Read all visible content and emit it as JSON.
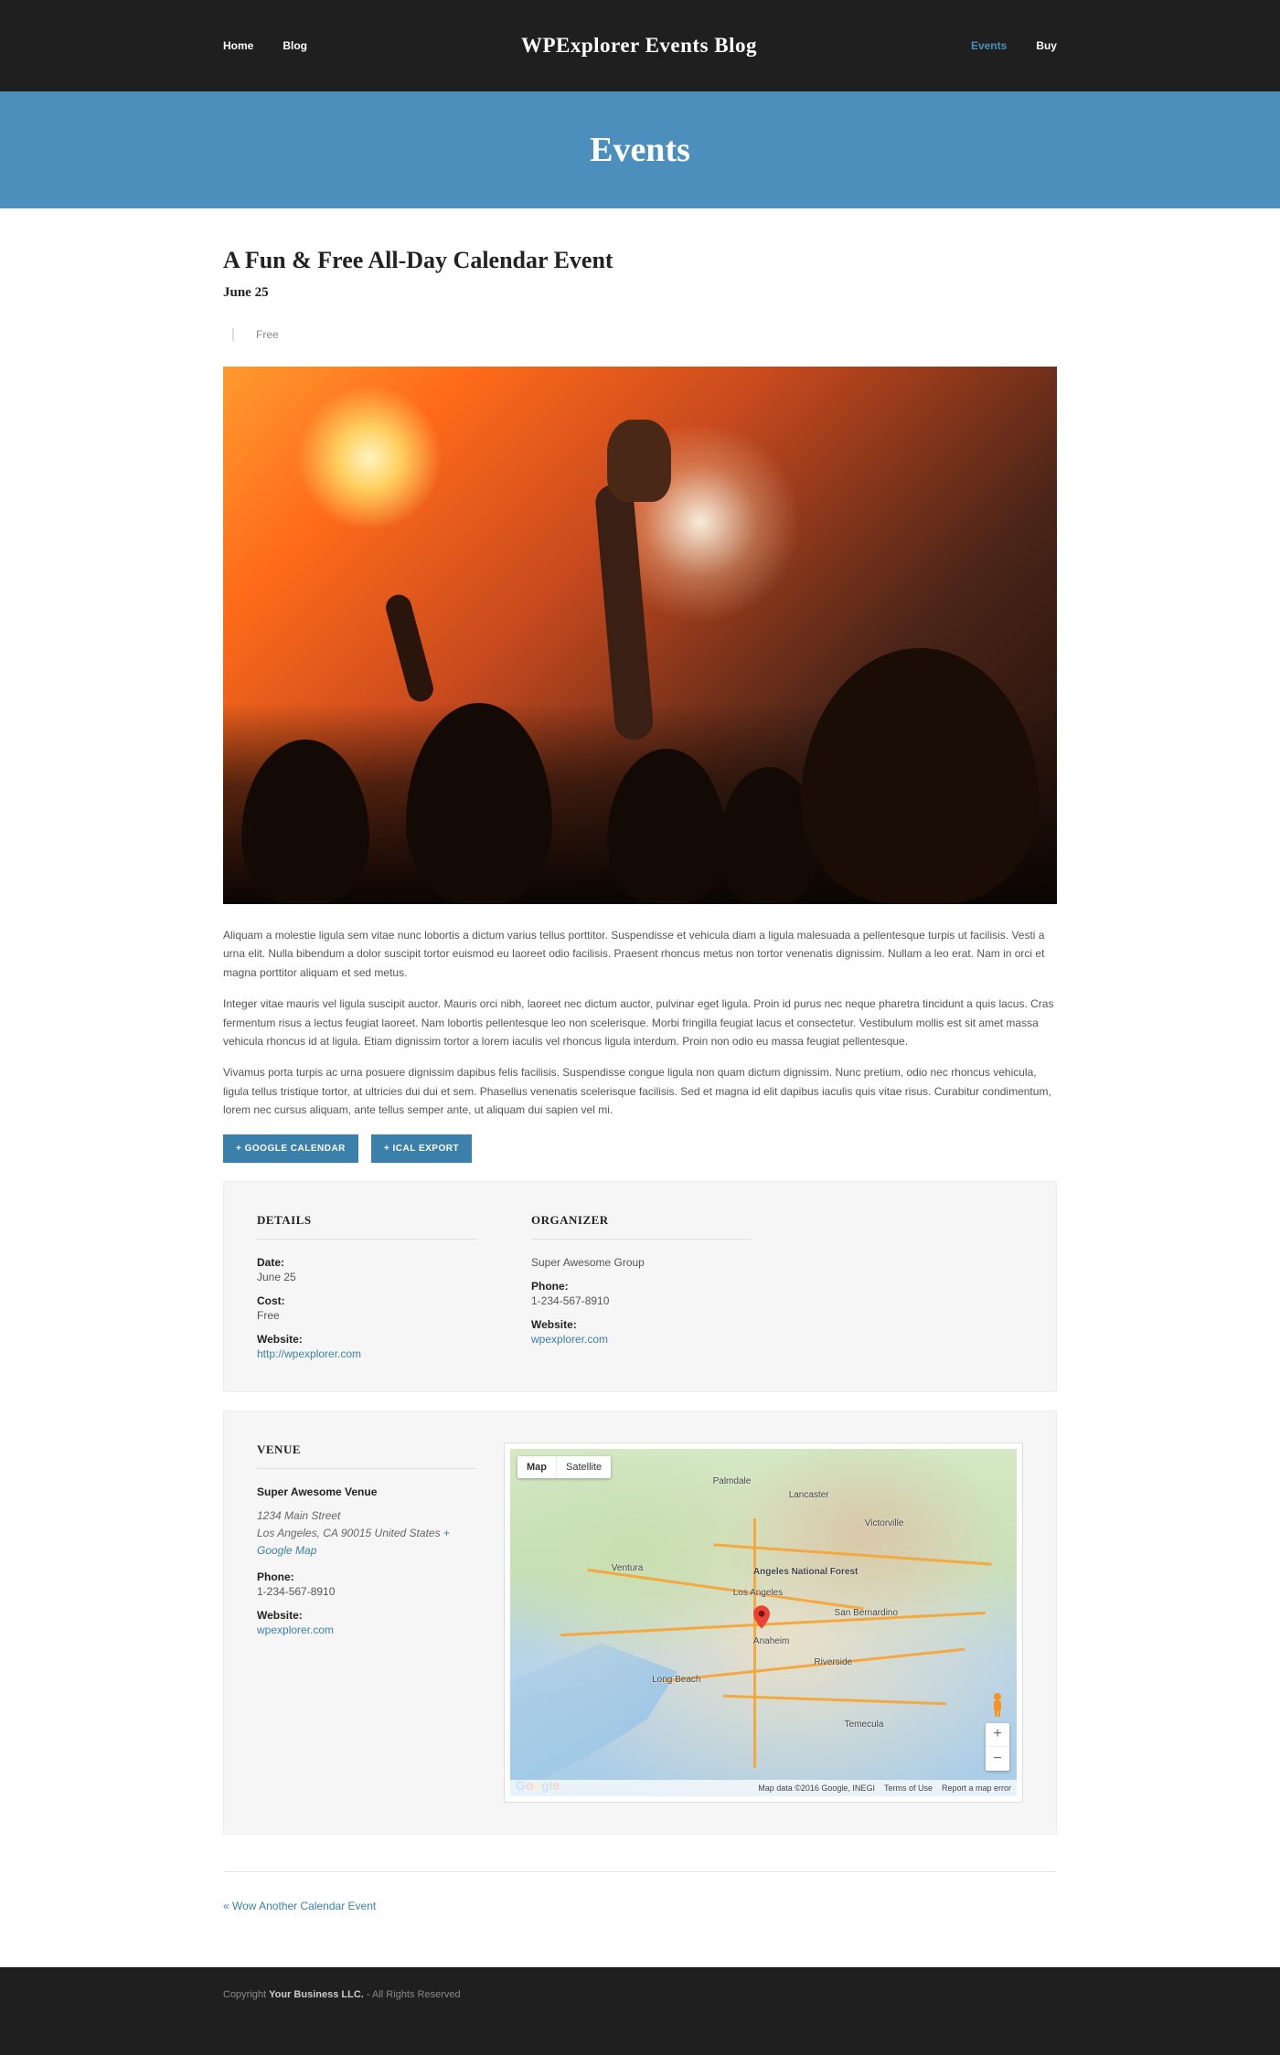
{
  "nav": {
    "left": [
      "Home",
      "Blog"
    ],
    "right": [
      "Events",
      "Buy"
    ],
    "active": "Events"
  },
  "brand": "WPExplorer Events Blog",
  "banner_title": "Events",
  "event": {
    "title": "A Fun & Free All-Day Calendar Event",
    "date": "June 25",
    "cost_badge": "Free"
  },
  "paragraphs": [
    "Aliquam a molestie ligula sem vitae nunc lobortis a dictum varius tellus porttitor. Suspendisse et vehicula diam a ligula malesuada a pellentesque turpis ut facilisis. Vesti a urna elit. Nulla bibendum a dolor suscipit tortor euismod eu laoreet odio facilisis. Praesent rhoncus metus non tortor venenatis dignissim. Nullam a leo erat. Nam in orci et magna porttitor aliquam et sed metus.",
    "Integer vitae mauris vel ligula suscipit auctor. Mauris orci nibh, laoreet nec dictum auctor, pulvinar eget ligula. Proin id purus nec neque pharetra tincidunt a quis lacus. Cras fermentum risus a lectus feugiat laoreet. Nam lobortis pellentesque leo non scelerisque. Morbi fringilla feugiat lacus et consectetur. Vestibulum mollis est sit amet massa vehicula rhoncus id at ligula. Etiam dignissim tortor a lorem iaculis vel rhoncus ligula interdum. Proin non odio eu massa feugiat pellentesque.",
    "Vivamus porta turpis ac urna posuere dignissim dapibus felis facilisis. Suspendisse congue ligula non quam dictum dignissim. Nunc pretium, odio nec rhoncus vehicula, ligula tellus tristique tortor, at ultricies dui dui et sem. Phasellus venenatis scelerisque facilisis. Sed et magna id elit dapibus iaculis quis vitae risus. Curabitur condimentum, lorem nec cursus aliquam, ante tellus semper ante, ut aliquam dui sapien vel mi."
  ],
  "buttons": {
    "gcal": "+ GOOGLE CALENDAR",
    "ical": "+ ICAL EXPORT"
  },
  "details": {
    "heading": "DETAILS",
    "date_label": "Date:",
    "date_val": "June 25",
    "cost_label": "Cost:",
    "cost_val": "Free",
    "website_label": "Website:",
    "website_val": "http://wpexplorer.com"
  },
  "organizer": {
    "heading": "ORGANIZER",
    "name": "Super Awesome Group",
    "phone_label": "Phone:",
    "phone_val": "1-234-567-8910",
    "website_label": "Website:",
    "website_val": "wpexplorer.com"
  },
  "venue": {
    "heading": "VENUE",
    "name": "Super Awesome Venue",
    "addr1": "1234 Main Street",
    "addr2": "Los Angeles, CA 90015 United States",
    "gmap": "+ Google Map",
    "phone_label": "Phone:",
    "phone_val": "1-234-567-8910",
    "website_label": "Website:",
    "website_val": "wpexplorer.com"
  },
  "map": {
    "tab_map": "Map",
    "tab_sat": "Satellite",
    "cities": [
      "Lancaster",
      "Palmdale",
      "Victorville",
      "Ventura",
      "Los Angeles",
      "San Bernardino",
      "Anaheim",
      "Riverside",
      "Long Beach",
      "Temecula",
      "Angeles National Forest"
    ],
    "attribution": "Map data ©2016 Google, INEGI",
    "terms": "Terms of Use",
    "report": "Report a map error",
    "zoom_in": "+",
    "zoom_out": "−"
  },
  "prev_link": "« Wow Another Calendar Event",
  "footer": {
    "copyright_pre": "Copyright ",
    "biz": "Your Business LLC.",
    "rest": " - All Rights Reserved"
  }
}
